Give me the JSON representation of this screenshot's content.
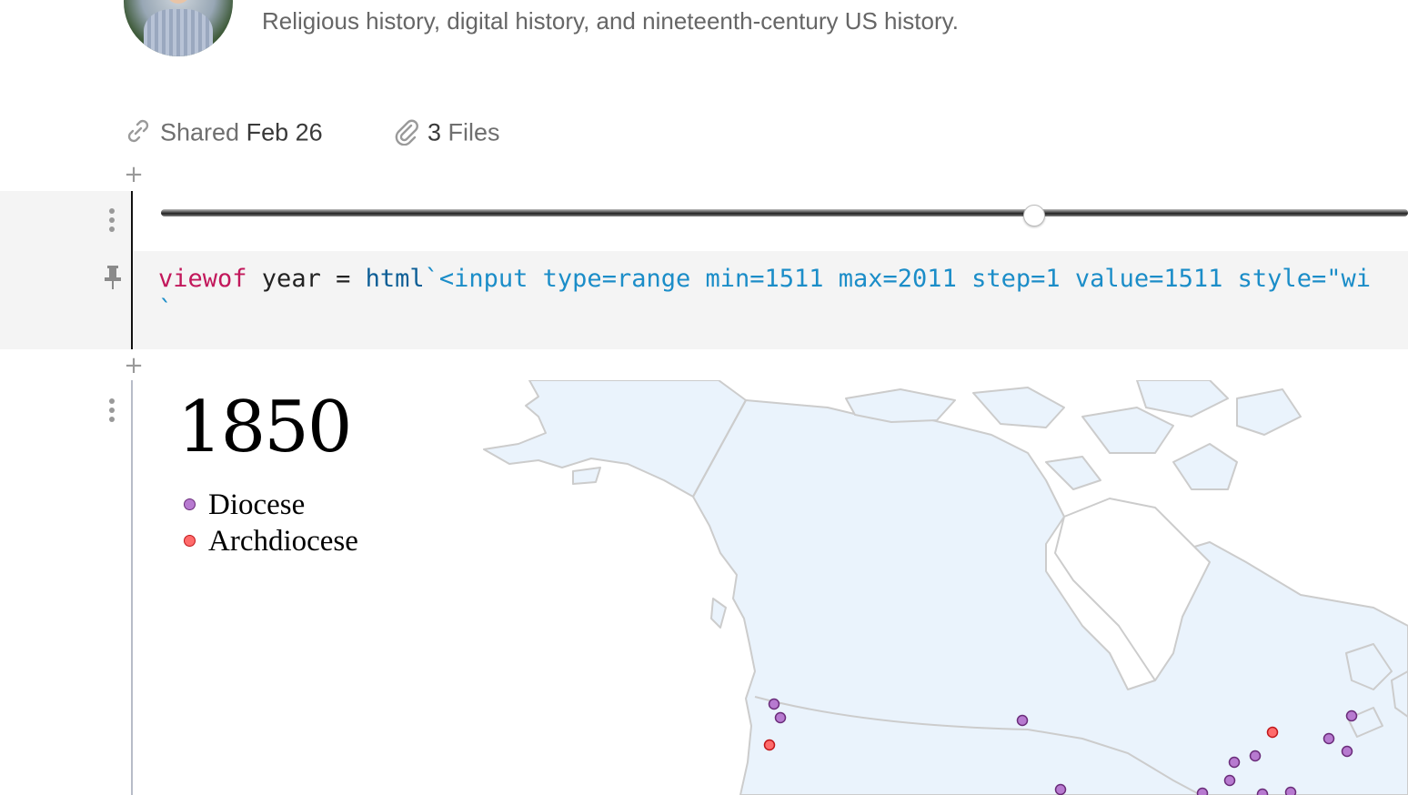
{
  "author": {
    "bio": "Religious history, digital history, and nineteenth-century US history."
  },
  "meta": {
    "shared_label": "Shared",
    "shared_date": "Feb 26",
    "files_count": "3",
    "files_label": "Files"
  },
  "cell1": {
    "slider": {
      "min": 1511,
      "max": 2011,
      "value": 1850
    },
    "code": {
      "keyword": "viewof",
      "var": " year = ",
      "fn": "html",
      "template": "`<input type=range min=1511 max=2011 step=1 value=1511 style=\"wi",
      "line2": "`"
    }
  },
  "cell2": {
    "year": "1850",
    "legend": [
      {
        "label": "Diocese",
        "color": "#9b59b6",
        "stroke": "#6a2c7a"
      },
      {
        "label": "Archdiocese",
        "color": "#ff4d4d",
        "stroke": "#c0161a"
      }
    ]
  },
  "colors": {
    "land": "#eaf3fc",
    "border": "#cccccc",
    "diocese": "#9b59b6",
    "archdiocese": "#ff4d4d"
  },
  "icons": [
    "link-icon",
    "paperclip-icon",
    "pin-icon",
    "menu-dots-icon",
    "plus-icon"
  ]
}
